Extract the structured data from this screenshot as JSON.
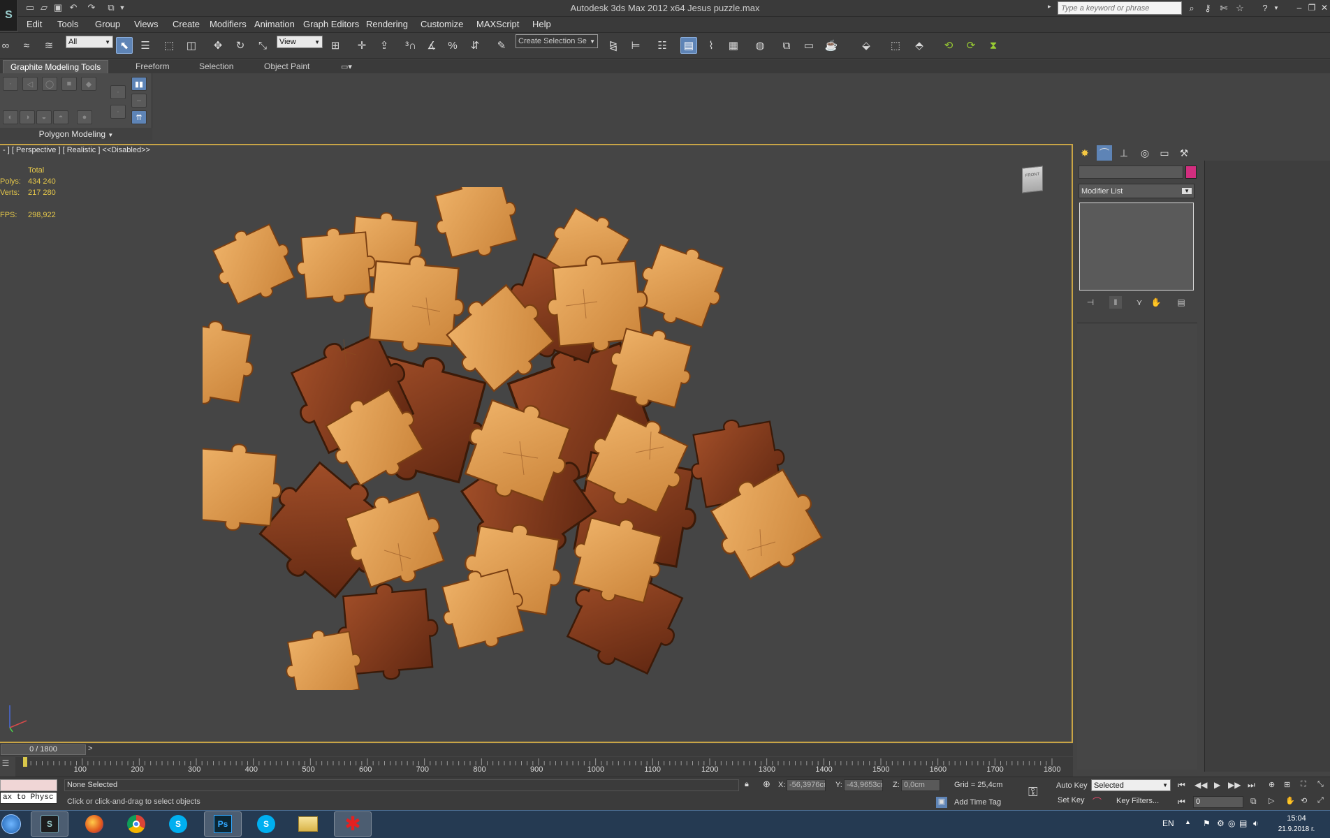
{
  "titlebar": {
    "title": "Autodesk 3ds Max  2012 x64      Jesus puzzle.max",
    "search_placeholder": "Type a keyword or phrase"
  },
  "menu": [
    "Edit",
    "Tools",
    "Group",
    "Views",
    "Create",
    "Modifiers",
    "Animation",
    "Graph Editors",
    "Rendering",
    "Customize",
    "MAXScript",
    "Help"
  ],
  "toolbar": {
    "filter_value": "All",
    "coord_value": "View",
    "selection_set_placeholder": "Create Selection Se"
  },
  "ribbon": {
    "tabs": [
      "Graphite Modeling Tools",
      "Freeform",
      "Selection",
      "Object Paint"
    ],
    "panel_title": "Polygon Modeling"
  },
  "viewport": {
    "label": "- ] [ Perspective ] [ Realistic ] <<Disabled>>",
    "stats": {
      "total_label": "Total",
      "polys_label": "Polys:",
      "polys": "434 240",
      "verts_label": "Verts:",
      "verts": "217 280",
      "fps_label": "FPS:",
      "fps": "298,922"
    },
    "viewcube_label": "FRONT"
  },
  "command_panel": {
    "modifier_list": "Modifier List"
  },
  "timeline": {
    "position": "0 / 1800",
    "current_frame": 0,
    "total_frames": 1800,
    "ticks": [
      "100",
      "200",
      "300",
      "400",
      "500",
      "600",
      "700",
      "800",
      "900",
      "1000",
      "1100",
      "1200",
      "1300",
      "1400",
      "1500",
      "1600",
      "1700",
      "1800"
    ]
  },
  "status": {
    "maxscript_listener": "ax to Physc",
    "selection": "None Selected",
    "prompt": "Click or click-and-drag to select objects",
    "x_label": "X:",
    "x": "-56,3976cr",
    "y_label": "Y:",
    "y": "-43,9653cr",
    "z_label": "Z:",
    "z": "0,0cm",
    "grid": "Grid = 25,4cm",
    "add_time_tag": "Add Time Tag",
    "auto_key": "Auto Key",
    "set_key": "Set Key",
    "key_mode": "Selected",
    "key_filters": "Key Filters...",
    "frame_field": "0"
  },
  "taskbar": {
    "lang": "EN",
    "time": "15:04",
    "date": "21.9.2018 г."
  },
  "colors": {
    "viewport_border": "#c8a446",
    "stats": "#e6c84a",
    "object_color": "#d22e7f",
    "active_tool": "#5e84b6"
  }
}
